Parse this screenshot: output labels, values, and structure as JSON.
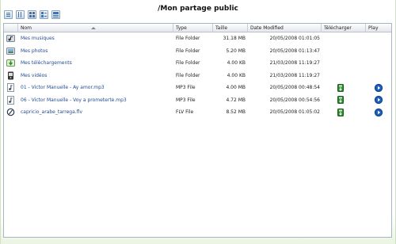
{
  "title": "/Mon partage public",
  "toolbar": [
    "view-list-icon",
    "view-columns-icon",
    "view-thumbnails-icon",
    "view-icons-icon",
    "view-details-icon"
  ],
  "columns": {
    "nom": "Nom",
    "type": "Type",
    "taille": "Taille",
    "date": "Date Modified",
    "telecharger": "Télécharger",
    "play": "Play"
  },
  "rows": [
    {
      "icon": "music-folder-icon",
      "name": "Mes musiques",
      "type": "File Folder",
      "size": "31.18 MB",
      "date": "20/05/2008 01:01:05",
      "download": false,
      "play": false
    },
    {
      "icon": "photo-folder-icon",
      "name": "Mes photos",
      "type": "File Folder",
      "size": "5.20 MB",
      "date": "20/05/2008 01:13:47",
      "download": false,
      "play": false
    },
    {
      "icon": "downloads-folder-icon",
      "name": "Mes téléchargements",
      "type": "File Folder",
      "size": "4.00 KB",
      "date": "21/03/2008 11:19:27",
      "download": false,
      "play": false
    },
    {
      "icon": "video-folder-icon",
      "name": "Mes vidéos",
      "type": "File Folder",
      "size": "4.00 KB",
      "date": "21/03/2008 11:19:27",
      "download": false,
      "play": false
    },
    {
      "icon": "mp3-file-icon",
      "name": "01 - Victor Manuelle - Ay amor.mp3",
      "type": "MP3 File",
      "size": "4.00 MB",
      "date": "20/05/2008 00:48:54",
      "download": true,
      "play": true
    },
    {
      "icon": "mp3-file-icon",
      "name": "06 - Victor Manuelle - Voy a prometerte.mp3",
      "type": "MP3 File",
      "size": "4.72 MB",
      "date": "20/05/2008 00:54:56",
      "download": true,
      "play": true
    },
    {
      "icon": "flv-file-icon",
      "name": "capricio_arabe_tarrega.flv",
      "type": "FLV File",
      "size": "8.52 MB",
      "date": "20/05/2008 01:05:02",
      "download": true,
      "play": true
    }
  ],
  "colors": {
    "link": "#234e91",
    "play": "#1a5fc0",
    "download": "#2e8b2e"
  }
}
